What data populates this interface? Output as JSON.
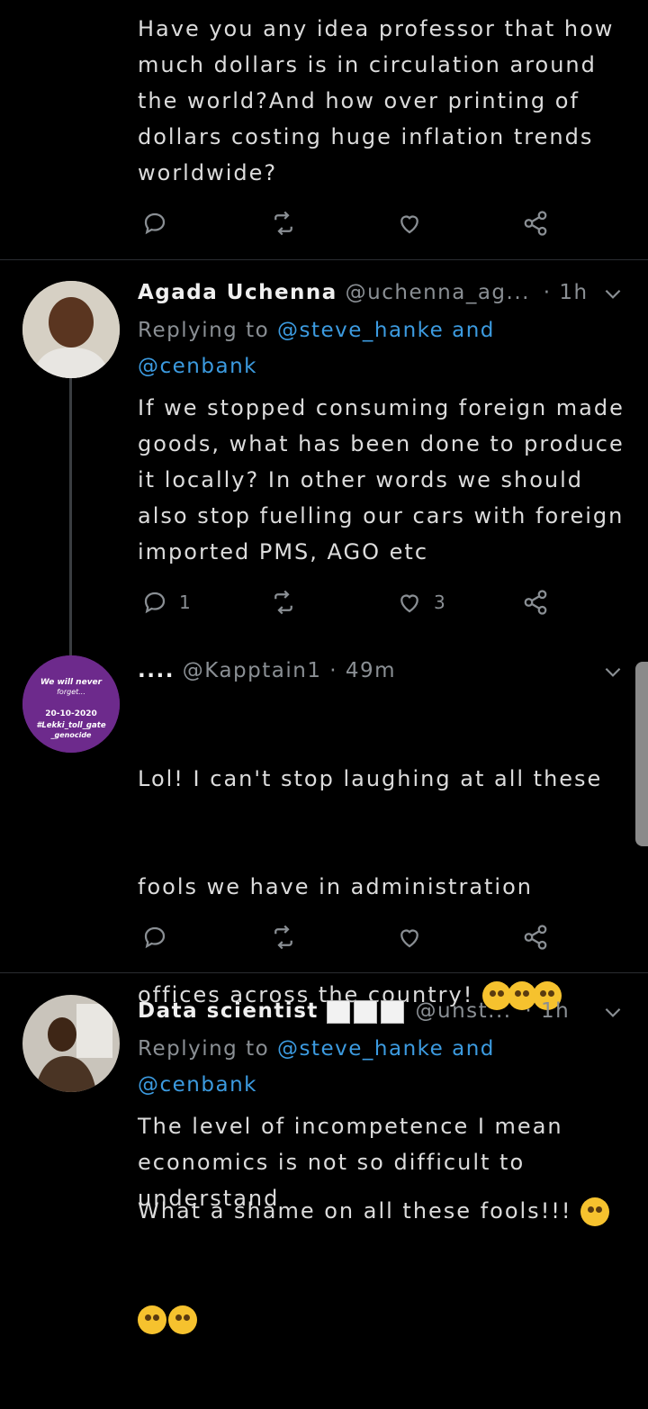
{
  "tweets": [
    {
      "text": "Have you any idea professor that how\nmuch dollars is in circulation around\nthe world?And how over printing of\ndollars costing huge inflation trends\nworldwide?",
      "replies": "",
      "likes": ""
    },
    {
      "name": "Agada Uchenna",
      "handle": "@uchenna_ag...",
      "time": "· 1h",
      "replying_prefix": "Replying to ",
      "replying_to": "@steve_hanke",
      "replying_and": " and",
      "replying_to2": "@cenbank",
      "text": "If we stopped consuming foreign made\ngoods, what has been done to produce\nit locally? In other words we should\nalso stop fuelling our cars with foreign\nimported PMS, AGO etc",
      "replies": "1",
      "likes": "3"
    },
    {
      "name": "....",
      "handle": "@Kapptain1",
      "time": "· 49m",
      "avatar_text": [
        "We will never",
        "forget...",
        "20-10-2020",
        "#Lekki_toll_gate",
        "_genocide"
      ],
      "text_line1": "Lol! I can't stop laughing at all these",
      "text_line2": "fools we have in administration",
      "text_line3": "offices across the country!",
      "text_line4": "What a shame on all these fools!!!",
      "replies": "",
      "likes": ""
    },
    {
      "name": "Data scientist",
      "handle": "@unst...",
      "time": "· 1h",
      "replying_prefix": "Replying to ",
      "replying_to": "@steve_hanke",
      "replying_and": " and",
      "replying_to2": "@cenbank",
      "text": "The level of incompetence I mean\neconomics is not so difficult to\nunderstand"
    }
  ],
  "colors": {
    "background": "#000000",
    "link": "#3c9be0",
    "muted": "#8a8f94",
    "accent_purple": "#6d2a8c"
  },
  "icons": [
    "reply-icon",
    "retweet-icon",
    "like-icon",
    "share-icon",
    "chevron-down-icon"
  ]
}
